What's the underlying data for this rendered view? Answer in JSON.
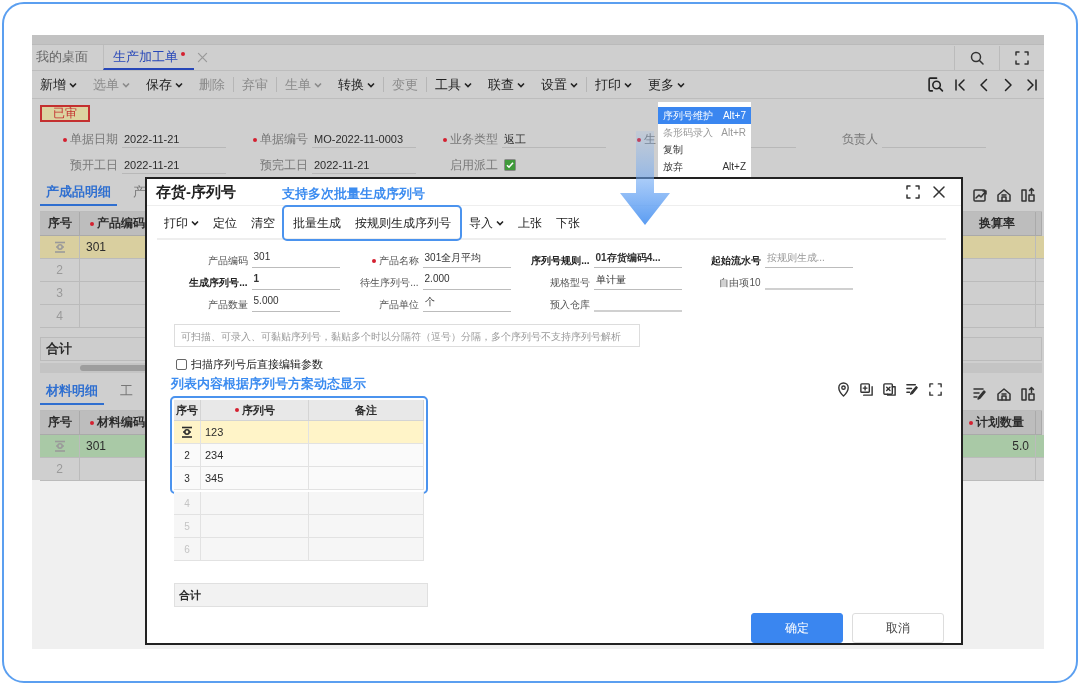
{
  "app_tabs": [
    {
      "label": "我的桌面",
      "selected": false,
      "modified": false
    },
    {
      "label": "生产加工单",
      "selected": true,
      "modified": true
    }
  ],
  "toolbar_groups": [
    [
      {
        "label": "新增",
        "dropdown": true,
        "disabled": false
      },
      {
        "label": "选单",
        "dropdown": true,
        "disabled": true
      },
      {
        "label": "保存",
        "dropdown": true,
        "disabled": false
      },
      {
        "label": "删除",
        "dropdown": false,
        "disabled": true
      }
    ],
    [
      {
        "label": "弃审",
        "dropdown": false,
        "disabled": true
      }
    ],
    [
      {
        "label": "生单",
        "dropdown": true,
        "disabled": true
      },
      {
        "label": "转换",
        "dropdown": true,
        "disabled": false
      }
    ],
    [
      {
        "label": "变更",
        "dropdown": false,
        "disabled": true
      }
    ],
    [
      {
        "label": "工具",
        "dropdown": true,
        "disabled": false
      },
      {
        "label": "联查",
        "dropdown": true,
        "disabled": false
      },
      {
        "label": "设置",
        "dropdown": true,
        "disabled": false
      }
    ],
    [
      {
        "label": "打印",
        "dropdown": true,
        "disabled": false
      },
      {
        "label": "更多",
        "dropdown": true,
        "disabled": false
      }
    ]
  ],
  "status_badge": "已审",
  "header_rows": [
    [
      {
        "kind": "text",
        "label": "单据日期",
        "required": true,
        "value": "2022-11-21"
      },
      {
        "kind": "text",
        "label": "单据编号",
        "required": true,
        "value": "MO-2022-11-0003"
      },
      {
        "kind": "text",
        "label": "业务类型",
        "required": true,
        "value": "返工"
      },
      {
        "kind": "text",
        "label": "生",
        "required": true,
        "clipped": true
      },
      {
        "kind": "text",
        "label": "负责人",
        "required": false
      }
    ],
    [
      {
        "kind": "text",
        "label": "预开工日",
        "required": false,
        "value": "2022-11-21"
      },
      {
        "kind": "text",
        "label": "预完工日",
        "required": false,
        "value": "2022-11-21"
      },
      {
        "kind": "checkbox",
        "label": "启用派工",
        "required": false,
        "checked": true
      }
    ]
  ],
  "product_tabs": [
    {
      "label": "产成品明细",
      "selected": true
    },
    {
      "label": "产",
      "selected": false
    }
  ],
  "product_grid": {
    "kind": "product",
    "columns": [
      {
        "label": "序号",
        "required": false
      },
      {
        "label": "产品编码",
        "required": true
      },
      {
        "label": "换算率",
        "required": false
      }
    ],
    "rows": [
      {
        "selected": true,
        "code": "301"
      },
      {
        "number": "2",
        "selected": false
      },
      {
        "number": "3",
        "selected": false
      },
      {
        "number": "4",
        "selected": false
      }
    ],
    "total_label": "合计"
  },
  "material_tabs": [
    {
      "label": "材料明细",
      "selected": true
    },
    {
      "label": "工",
      "selected": false
    }
  ],
  "material_grid": {
    "kind": "material",
    "columns": [
      {
        "label": "序号",
        "required": false
      },
      {
        "label": "材料编码",
        "required": true
      },
      {
        "label": "计划数量",
        "required": true
      }
    ],
    "rows": [
      {
        "selected": true,
        "code": "301",
        "quantity": "5.0"
      },
      {
        "number": "2",
        "selected": false
      }
    ]
  },
  "context_menu": [
    {
      "label": "序列号维护",
      "shortcut": "Alt+7",
      "selected": true,
      "disabled": false
    },
    {
      "label": "条形码录入",
      "shortcut": "Alt+R",
      "selected": false,
      "disabled": true
    },
    {
      "label": "复制",
      "selected": false,
      "disabled": false
    },
    {
      "label": "放弃",
      "shortcut": "Alt+Z",
      "selected": false,
      "disabled": false
    }
  ],
  "dialog": {
    "title": "存货-序列号",
    "title_note": "支持多次批量生成序列号",
    "toolbar": [
      {
        "kind": "button",
        "label": "打印",
        "dropdown": true
      },
      {
        "kind": "button",
        "label": "定位",
        "dropdown": false
      },
      {
        "kind": "button",
        "label": "清空",
        "dropdown": false
      },
      {
        "kind": "highlight_group",
        "items": [
          {
            "label": "批量生成",
            "dropdown": false
          },
          {
            "label": "按规则生成序列号",
            "dropdown": false
          }
        ]
      },
      {
        "kind": "button",
        "label": "导入",
        "dropdown": true
      },
      {
        "kind": "button",
        "label": "上张",
        "dropdown": false
      },
      {
        "kind": "button",
        "label": "下张",
        "dropdown": false
      }
    ],
    "field_rows": [
      [
        {
          "label": "产品编码",
          "value": "301",
          "required": false,
          "emphasized": false
        },
        {
          "label": "产品名称",
          "value": "301全月平均",
          "required": true,
          "emphasized": false
        },
        {
          "label": "序列号规则...",
          "value": "01存货编码4...",
          "required": false,
          "emphasized": true
        },
        {
          "label": "起始流水号",
          "placeholder": "按规则生成...",
          "required": false,
          "emphasized": true
        }
      ],
      [
        {
          "label": "生成序列号...",
          "value": "1",
          "required": false,
          "emphasized": true
        },
        {
          "label": "待生序列号...",
          "value": "2.000",
          "required": false,
          "emphasized": false
        },
        {
          "label": "规格型号",
          "value": "单计量",
          "required": false,
          "emphasized": false
        },
        {
          "label": "自由项10",
          "required": false,
          "emphasized": false
        }
      ],
      [
        {
          "label": "产品数量",
          "value": "5.000",
          "required": false,
          "emphasized": false
        },
        {
          "label": "产品单位",
          "value": "个",
          "required": false,
          "emphasized": false
        },
        {
          "label": "预入仓库",
          "required": false,
          "emphasized": false
        }
      ]
    ],
    "serial_input": {
      "placeholder": "可扫描、可录入、可黏贴序列号，黏贴多个时以分隔符（逗号）分隔，多个序列号不支持序列号解析"
    },
    "option": {
      "label": "扫描序列号后直接编辑参数",
      "checked": false
    },
    "list_note": "列表内容根据序列号方案动态显示",
    "grid": {
      "columns": [
        {
          "label": "序号",
          "required": false
        },
        {
          "label": "序列号",
          "required": true
        },
        {
          "label": "备注",
          "required": false
        }
      ],
      "framed_rows": [
        {
          "selected": true,
          "serial": "123"
        },
        {
          "number": "2",
          "serial": "234",
          "selected": false
        },
        {
          "number": "3",
          "serial": "345",
          "selected": false
        }
      ],
      "rows": [
        {
          "number": "4",
          "selected": false
        },
        {
          "number": "5",
          "selected": false
        },
        {
          "number": "6",
          "selected": false
        }
      ],
      "total_label": "合计"
    },
    "buttons": [
      {
        "label": "确定",
        "primary": true
      },
      {
        "label": "取消",
        "primary": false
      }
    ]
  }
}
